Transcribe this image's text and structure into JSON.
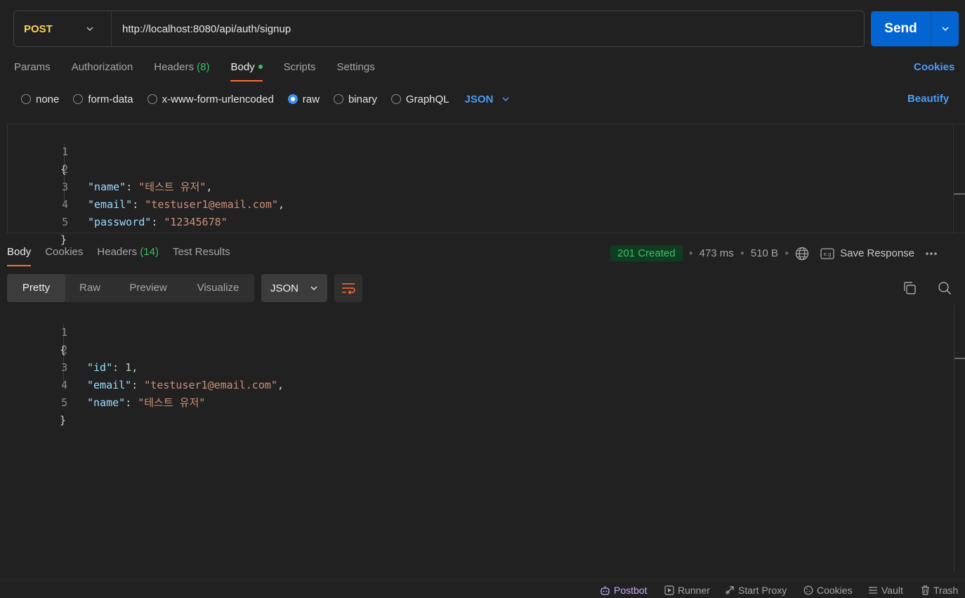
{
  "request": {
    "method": "POST",
    "url": "http://localhost:8080/api/auth/signup",
    "send_label": "Send"
  },
  "request_tabs": [
    {
      "label": "Params"
    },
    {
      "label": "Authorization"
    },
    {
      "label": "Headers",
      "count": "(8)"
    },
    {
      "label": "Body",
      "active": true
    },
    {
      "label": "Scripts"
    },
    {
      "label": "Settings"
    }
  ],
  "cookies_link": "Cookies",
  "body_types": [
    "none",
    "form-data",
    "x-www-form-urlencoded",
    "raw",
    "binary",
    "GraphQL"
  ],
  "body_selected": "raw",
  "body_language": "JSON",
  "beautify_label": "Beautify",
  "request_body_lines": [
    {
      "n": "1",
      "text": "{"
    },
    {
      "n": "2",
      "key": "\"name\"",
      "value": "\"테스트 유저\"",
      "trail": ","
    },
    {
      "n": "3",
      "key": "\"email\"",
      "value": "\"testuser1@email.com\"",
      "trail": ","
    },
    {
      "n": "4",
      "key": "\"password\"",
      "value": "\"12345678\"",
      "trail": ""
    },
    {
      "n": "5",
      "text": "}"
    }
  ],
  "response_tabs": [
    {
      "label": "Body",
      "active": true
    },
    {
      "label": "Cookies"
    },
    {
      "label": "Headers",
      "count": "(14)"
    },
    {
      "label": "Test Results"
    }
  ],
  "response_status": {
    "status": "201 Created",
    "time": "473 ms",
    "size": "510 B",
    "save_label": "Save Response"
  },
  "view_modes": [
    "Pretty",
    "Raw",
    "Preview",
    "Visualize"
  ],
  "view_selected": "Pretty",
  "response_format": "JSON",
  "response_body_lines": [
    {
      "n": "1",
      "text": "{"
    },
    {
      "n": "2",
      "key": "\"id\"",
      "number": "1",
      "trail": ","
    },
    {
      "n": "3",
      "key": "\"email\"",
      "value": "\"testuser1@email.com\"",
      "trail": ","
    },
    {
      "n": "4",
      "key": "\"name\"",
      "value": "\"테스트 유저\"",
      "trail": ""
    },
    {
      "n": "5",
      "text": "}"
    }
  ],
  "footer": {
    "postbot": "Postbot",
    "runner": "Runner",
    "proxy": "Start Proxy",
    "cookies": "Cookies",
    "vault": "Vault",
    "trash": "Trash"
  },
  "colors": {
    "background": "#212121",
    "accent_orange": "#ff6c37",
    "primary_blue": "#0265d2",
    "link_blue": "#4b9cf5",
    "success_green": "#3bbf6a",
    "method_yellow": "#f7d25a"
  }
}
